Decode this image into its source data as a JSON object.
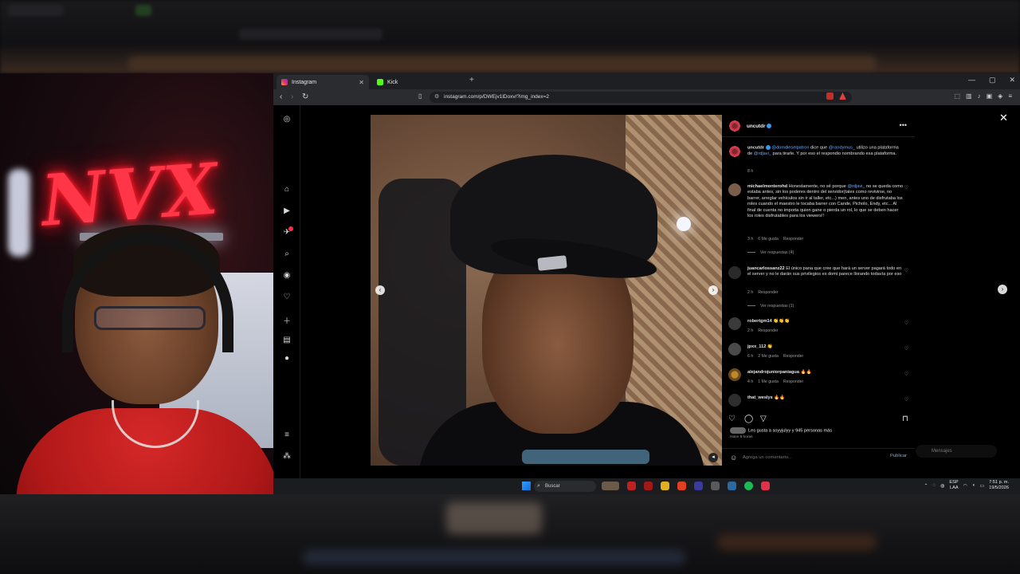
{
  "browser": {
    "tabs": [
      {
        "label": "Instagram",
        "icon": "instagram-icon",
        "active": true
      },
      {
        "label": "Kick",
        "icon": "kick-icon",
        "active": false
      }
    ],
    "url": "instagram.com/p/DWEjv1lDoxv/?img_index=2"
  },
  "post": {
    "author": "uncutdr",
    "caption": {
      "user": "uncutdr",
      "tag1": "@domdieselpatron",
      "text1": " dice que ",
      "tag2": "@randymus_",
      "text2": " utilizo una plataforma de ",
      "tag3": "@rdjavi_",
      "text3": " para tirarle. Y por eso el respondio nombrando esa plataforma.",
      "time": "8 h"
    },
    "comments": [
      {
        "user": "michaelmonterohd",
        "text_a": " Honestamente, no sé porque ",
        "tag": "@rdjavi_",
        "text_b": " no se queda como estaba antes, sin los poderes dentro del servidor(tales como revivirse, no barrer, arreglar vehículos sin ir al taller, etc...) men, antes uno de disfrutaba los roles cuando el maestro le tocaba barrer con Cande, Picholo, Endy, etc... Al final de cuenta no importa quien gane o pierda un rol, lo que se deben hacer los roles disfrutables para los viewers!!",
        "time": "3 h",
        "likes": "6 Me gusta",
        "reply": "Responder",
        "view_replies": "Ver respuestas (4)"
      },
      {
        "user": "juancarlossanz22",
        "text_a": " El único pana que cree que hará un server pagará todo en el server y no le darán sus privilegios es domi parece llorando todavía por eso",
        "tag": "",
        "text_b": "",
        "time": "2 h",
        "likes": "",
        "reply": "Responder",
        "view_replies": "Ver respuestas (1)"
      },
      {
        "user": "robertgm14",
        "text": " 👏👏👏",
        "time": "2 h",
        "likes": "",
        "reply": "Responder"
      },
      {
        "user": "jpxx_112",
        "text": " 👏",
        "time": "6 h",
        "likes": "2 Me gusta",
        "reply": "Responder"
      },
      {
        "user": "alejandrojuniorpaniagua",
        "text": " 🔥🔥",
        "time": "4 h",
        "likes": "1 Me gusta",
        "reply": "Responder"
      },
      {
        "user": "that_weslys",
        "text": " 🔥🔥",
        "time": "",
        "likes": "",
        "reply": ""
      }
    ],
    "likes_line": "Les gusta a soyyjulyy y 945 personas más",
    "likes_time": "Hace 8 horas",
    "comment_placeholder": "Agrega un comentario...",
    "publish": "Publicar",
    "messages": "Mensajes"
  },
  "taskbar": {
    "search_label": "Buscar",
    "lang": "ESP",
    "lang2": "LAA",
    "time": "7:51 p. m.",
    "date": "19/5/2026"
  },
  "webcam": {
    "neon": "NVX"
  },
  "colors": {
    "instagram_blue": "#3897f0",
    "tag_blue": "#6aa9ff",
    "neon_red": "#ff3648",
    "kick_green": "#53fc18"
  }
}
